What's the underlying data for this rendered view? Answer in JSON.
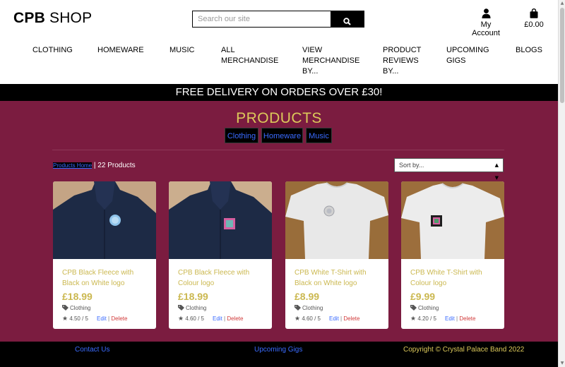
{
  "brand": {
    "name_bold": "CPB",
    "name_rest": " SHOP"
  },
  "search": {
    "placeholder": "Search our site"
  },
  "header": {
    "account_label": "My Account",
    "cart_total": "£0.00"
  },
  "nav": [
    {
      "label": "CLOTHING"
    },
    {
      "label": "HOMEWARE"
    },
    {
      "label": "MUSIC"
    },
    {
      "label": "ALL MERCHANDISE"
    },
    {
      "label": "VIEW MERCHANDISE BY..."
    },
    {
      "label": "PRODUCT REVIEWS BY..."
    },
    {
      "label": "UPCOMING GIGS"
    },
    {
      "label": "BLOGS"
    }
  ],
  "banner": {
    "text": "FREE DELIVERY ON ORDERS OVER £30!"
  },
  "main": {
    "title": "PRODUCTS",
    "categories": [
      {
        "label": "Clothing"
      },
      {
        "label": "Homeware"
      },
      {
        "label": "Music"
      }
    ],
    "breadcrumb_home": "Products Home",
    "breadcrumb_count": " | 22 Products",
    "sort_placeholder": "Sort by..."
  },
  "products": [
    {
      "name": "CPB Black Fleece with Black on White logo",
      "price": "£18.99",
      "category": "Clothing",
      "rating": "4.50 / 5",
      "edit": "Edit",
      "delete": "Delete"
    },
    {
      "name": "CPB Black Fleece with Colour logo",
      "price": "£18.99",
      "category": "Clothing",
      "rating": "4.60 / 5",
      "edit": "Edit",
      "delete": "Delete"
    },
    {
      "name": "CPB White T-Shirt with Black on White logo",
      "price": "£8.99",
      "category": "Clothing",
      "rating": "4.60 / 5",
      "edit": "Edit",
      "delete": "Delete"
    },
    {
      "name": "CPB White T-Shirt with Colour logo",
      "price": "£9.99",
      "category": "Clothing",
      "rating": "4.20 / 5",
      "edit": "Edit",
      "delete": "Delete"
    }
  ],
  "footer": {
    "contact": "Contact Us",
    "gigs": "Upcoming Gigs",
    "copyright": "Copyright © Crystal Palace Band 2022"
  },
  "colors": {
    "maroon": "#7b1c40",
    "gold": "#dcc95a",
    "link_blue": "#3a6bff",
    "delete_red": "#d13b3b"
  }
}
